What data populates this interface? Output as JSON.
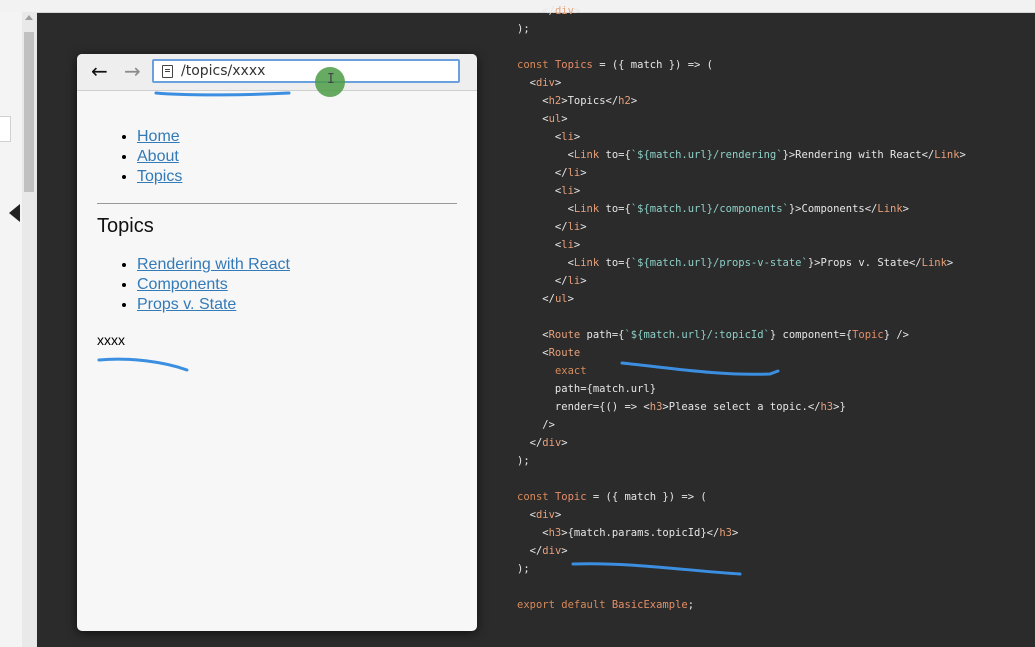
{
  "browser": {
    "address": "/topics/xxxx",
    "back_icon": "←",
    "forward_icon": "→",
    "nav_links": [
      "Home",
      "About",
      "Topics"
    ],
    "topics_heading": "Topics",
    "topic_links": [
      "Rendering with React",
      "Components",
      "Props v. State"
    ],
    "topic_id": "xxxx"
  },
  "code": {
    "lines": [
      {
        "y": 0,
        "html": "    </div>"
      },
      {
        "y": 1,
        "html": ");"
      },
      {
        "y": 3,
        "html": "const Topics = ({ match }) => ("
      },
      {
        "y": 4,
        "html": "  <div>"
      },
      {
        "y": 5,
        "html": "    <h2>Topics</h2>"
      },
      {
        "y": 6,
        "html": "    <ul>"
      },
      {
        "y": 7,
        "html": "      <li>"
      },
      {
        "y": 8,
        "html": "        <Link to={`${match.url}/rendering`}>Rendering with React</Link>"
      },
      {
        "y": 9,
        "html": "      </li>"
      },
      {
        "y": 10,
        "html": "      <li>"
      },
      {
        "y": 11,
        "html": "        <Link to={`${match.url}/components`}>Components</Link>"
      },
      {
        "y": 12,
        "html": "      </li>"
      },
      {
        "y": 13,
        "html": "      <li>"
      },
      {
        "y": 14,
        "html": "        <Link to={`${match.url}/props-v-state`}>Props v. State</Link>"
      },
      {
        "y": 15,
        "html": "      </li>"
      },
      {
        "y": 16,
        "html": "    </ul>"
      },
      {
        "y": 18,
        "html": "    <Route path={`${match.url}/:topicId`} component={Topic} />"
      },
      {
        "y": 19,
        "html": "    <Route"
      },
      {
        "y": 20,
        "html": "      exact"
      },
      {
        "y": 21,
        "html": "      path={match.url}"
      },
      {
        "y": 22,
        "html": "      render={() => <h3>Please select a topic.</h3>}"
      },
      {
        "y": 23,
        "html": "    />"
      },
      {
        "y": 24,
        "html": "  </div>"
      },
      {
        "y": 25,
        "html": ");"
      },
      {
        "y": 27,
        "html": "const Topic = ({ match }) => ("
      },
      {
        "y": 28,
        "html": "  <div>"
      },
      {
        "y": 29,
        "html": "    <h3>{match.params.topicId}</h3>"
      },
      {
        "y": 30,
        "html": "  </div>"
      },
      {
        "y": 31,
        "html": ");"
      },
      {
        "y": 33,
        "html": "export default BasicExample;"
      }
    ]
  }
}
